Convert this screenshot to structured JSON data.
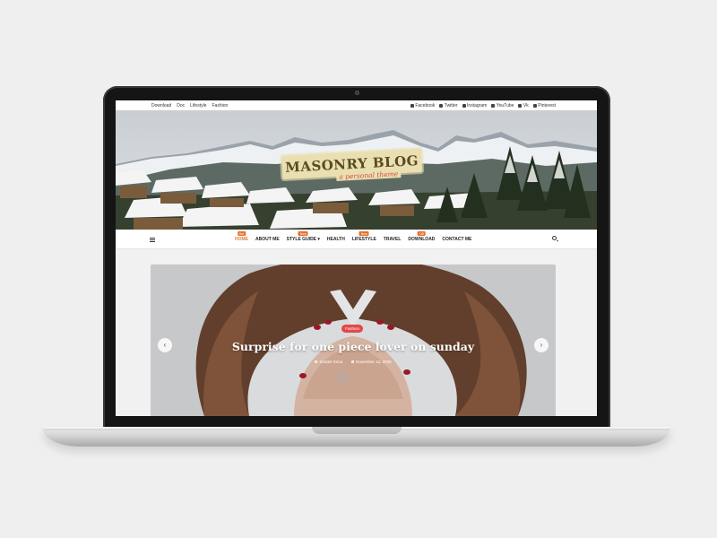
{
  "topbar": {
    "links": [
      "Download",
      "Doc",
      "Lifestyle",
      "Fashion"
    ],
    "social": [
      {
        "icon": "facebook-icon",
        "label": "Facebook"
      },
      {
        "icon": "twitter-icon",
        "label": "Twitter"
      },
      {
        "icon": "instagram-icon",
        "label": "Instagram"
      },
      {
        "icon": "youtube-icon",
        "label": "YouTube"
      },
      {
        "icon": "vk-icon",
        "label": "Vk"
      },
      {
        "icon": "pinterest-icon",
        "label": "Pinterest"
      }
    ]
  },
  "header": {
    "logo_title": "MASONRY BLOG",
    "logo_subtitle": "a personal theme"
  },
  "nav": {
    "items": [
      {
        "label": "HOME",
        "badge": "Hot",
        "active": true
      },
      {
        "label": "ABOUT ME",
        "badge": "",
        "active": false
      },
      {
        "label": "STYLE GUIDE ▾",
        "badge": "New",
        "active": false
      },
      {
        "label": "HEALTH",
        "badge": "",
        "active": false
      },
      {
        "label": "LIFESTYLE",
        "badge": "New",
        "active": false
      },
      {
        "label": "TRAVEL",
        "badge": "",
        "active": false
      },
      {
        "label": "DOWNLOAD",
        "badge": "Off",
        "active": false
      },
      {
        "label": "CONTACT ME",
        "badge": "",
        "active": false
      }
    ]
  },
  "slider": {
    "category": "Fashion",
    "title": "Surprise for one piece lover on sunday",
    "author": "Zoeder Erica",
    "date": "November 12, 2018",
    "prev_glyph": "‹",
    "next_glyph": "›"
  },
  "colors": {
    "accent": "#e5702d",
    "category_badge": "#e4474a"
  }
}
